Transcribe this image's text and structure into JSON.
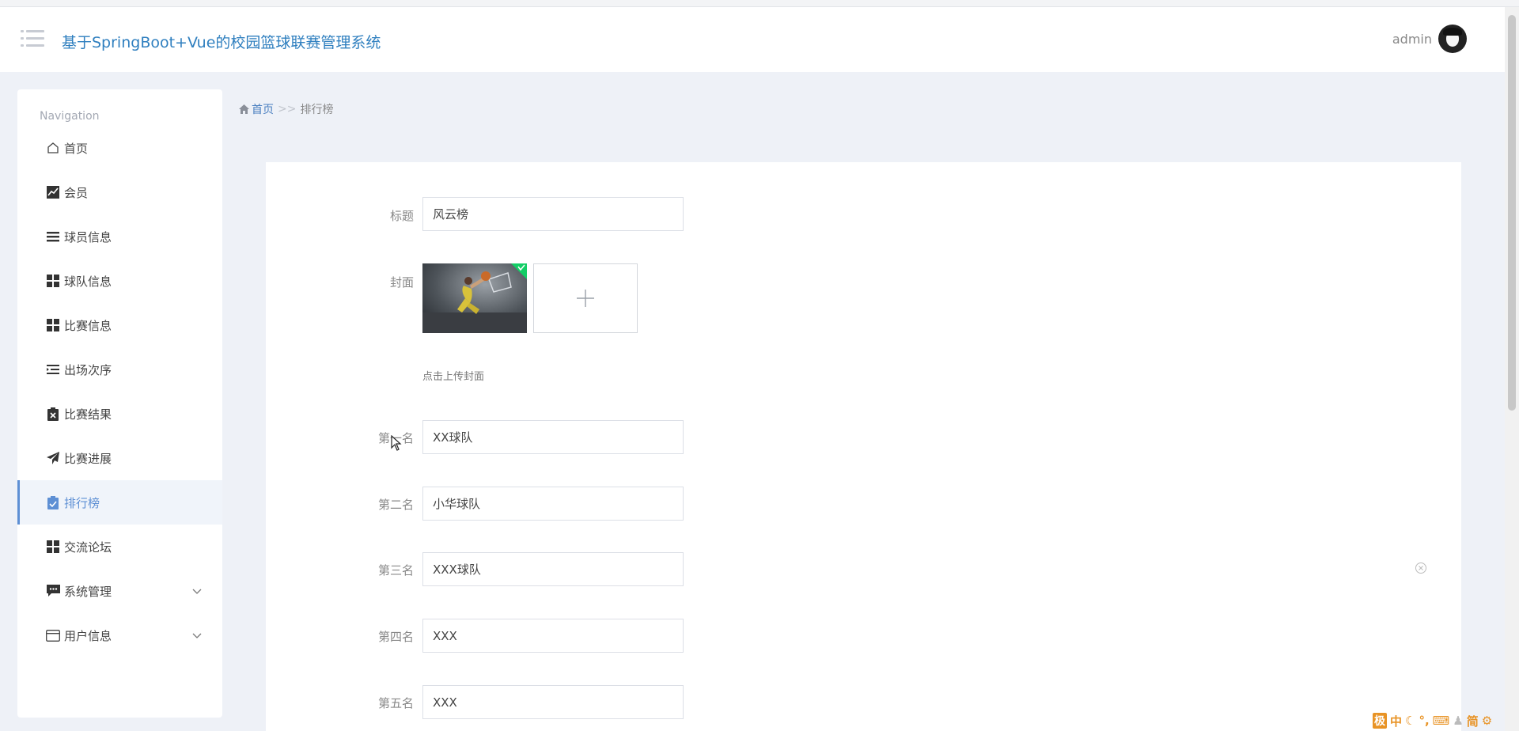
{
  "header": {
    "app_title": "基于SpringBoot+Vue的校园篮球联赛管理系统",
    "user_name": "admin"
  },
  "sidebar": {
    "title": "Navigation",
    "items": [
      {
        "label": "首页",
        "icon": "home-icon"
      },
      {
        "label": "会员",
        "icon": "chart-line-icon"
      },
      {
        "label": "球员信息",
        "icon": "list-icon"
      },
      {
        "label": "球队信息",
        "icon": "grid-icon"
      },
      {
        "label": "比赛信息",
        "icon": "grid-icon"
      },
      {
        "label": "出场次序",
        "icon": "list-indent-icon"
      },
      {
        "label": "比赛结果",
        "icon": "clipboard-x-icon"
      },
      {
        "label": "比赛进展",
        "icon": "send-icon"
      },
      {
        "label": "排行榜",
        "icon": "clipboard-check-icon",
        "active": true
      },
      {
        "label": "交流论坛",
        "icon": "grid-icon"
      },
      {
        "label": "系统管理",
        "icon": "chat-icon",
        "expandable": true
      },
      {
        "label": "用户信息",
        "icon": "credit-card-icon",
        "expandable": true
      }
    ]
  },
  "breadcrumb": {
    "home": "首页",
    "separator": ">>",
    "current": "排行榜"
  },
  "form": {
    "title_label": "标题",
    "title_value": "风云榜",
    "cover_label": "封面",
    "upload_tip": "点击上传封面",
    "rank1_label": "第一名",
    "rank1_value": "XX球队",
    "rank2_label": "第二名",
    "rank2_value": "小华球队",
    "rank3_label": "第三名",
    "rank3_value": "XXX球队",
    "rank4_label": "第四名",
    "rank4_value": "XXX",
    "rank5_label": "第五名",
    "rank5_value": "XXX"
  },
  "ime_toolbar": {
    "mode": "中",
    "script": "简"
  },
  "colors": {
    "accent": "#4a7fc0",
    "title_blue": "#2f7fbf",
    "active_bg": "#f0f4fa",
    "upload_success": "#13ce66",
    "ime_orange": "#e89325"
  }
}
